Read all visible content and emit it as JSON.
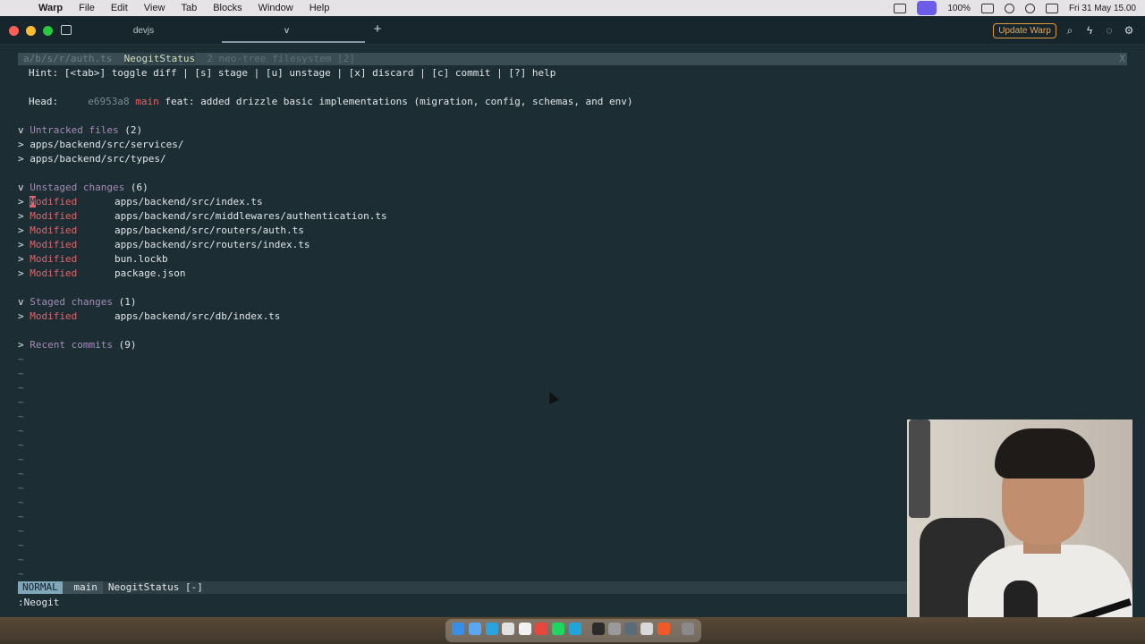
{
  "menubar": {
    "app_name": "Warp",
    "menus": [
      "File",
      "Edit",
      "View",
      "Tab",
      "Blocks",
      "Window",
      "Help"
    ],
    "battery": "100%",
    "datetime": "Fri 31 May  15.00"
  },
  "titlebar": {
    "tabs": [
      "devjs",
      "v"
    ],
    "update_label": "Update Warp"
  },
  "buffers": {
    "tab1": "a/b/s/r/auth.ts",
    "tab2": "NeogitStatus",
    "tab3": "2 neo-tree filesystem [2]",
    "close": "X"
  },
  "neogit": {
    "hint": "Hint: [<tab>] toggle diff | [s] stage | [u] unstage | [x] discard | [c] commit | [?] help",
    "head_label": "Head:",
    "head_hash": "e6953a8",
    "head_branch": "main",
    "head_message": "feat: added drizzle basic implementations (migration, config, schemas, and env)",
    "untracked": {
      "fold": "v",
      "title": "Untracked files",
      "count": "(2)",
      "items": [
        "apps/backend/src/services/",
        "apps/backend/src/types/"
      ]
    },
    "unstaged": {
      "fold": "v",
      "title": "Unstaged changes",
      "count": "(6)",
      "items": [
        {
          "status": "Modified",
          "path": "apps/backend/src/index.ts"
        },
        {
          "status": "Modified",
          "path": "apps/backend/src/middlewares/authentication.ts"
        },
        {
          "status": "Modified",
          "path": "apps/backend/src/routers/auth.ts"
        },
        {
          "status": "Modified",
          "path": "apps/backend/src/routers/index.ts"
        },
        {
          "status": "Modified",
          "path": "bun.lockb"
        },
        {
          "status": "Modified",
          "path": "package.json"
        }
      ]
    },
    "staged": {
      "fold": "v",
      "title": "Staged changes",
      "count": "(1)",
      "items": [
        {
          "status": "Modified",
          "path": "apps/backend/src/db/index.ts"
        }
      ]
    },
    "recent": {
      "fold": ">",
      "title": "Recent commits",
      "count": "(9)"
    },
    "item_marker": ">",
    "tilde": "~"
  },
  "statusline": {
    "mode": "NORMAL",
    "branch": " main",
    "file": "NeogitStatus [-]"
  },
  "cmdline": ":Neogit"
}
